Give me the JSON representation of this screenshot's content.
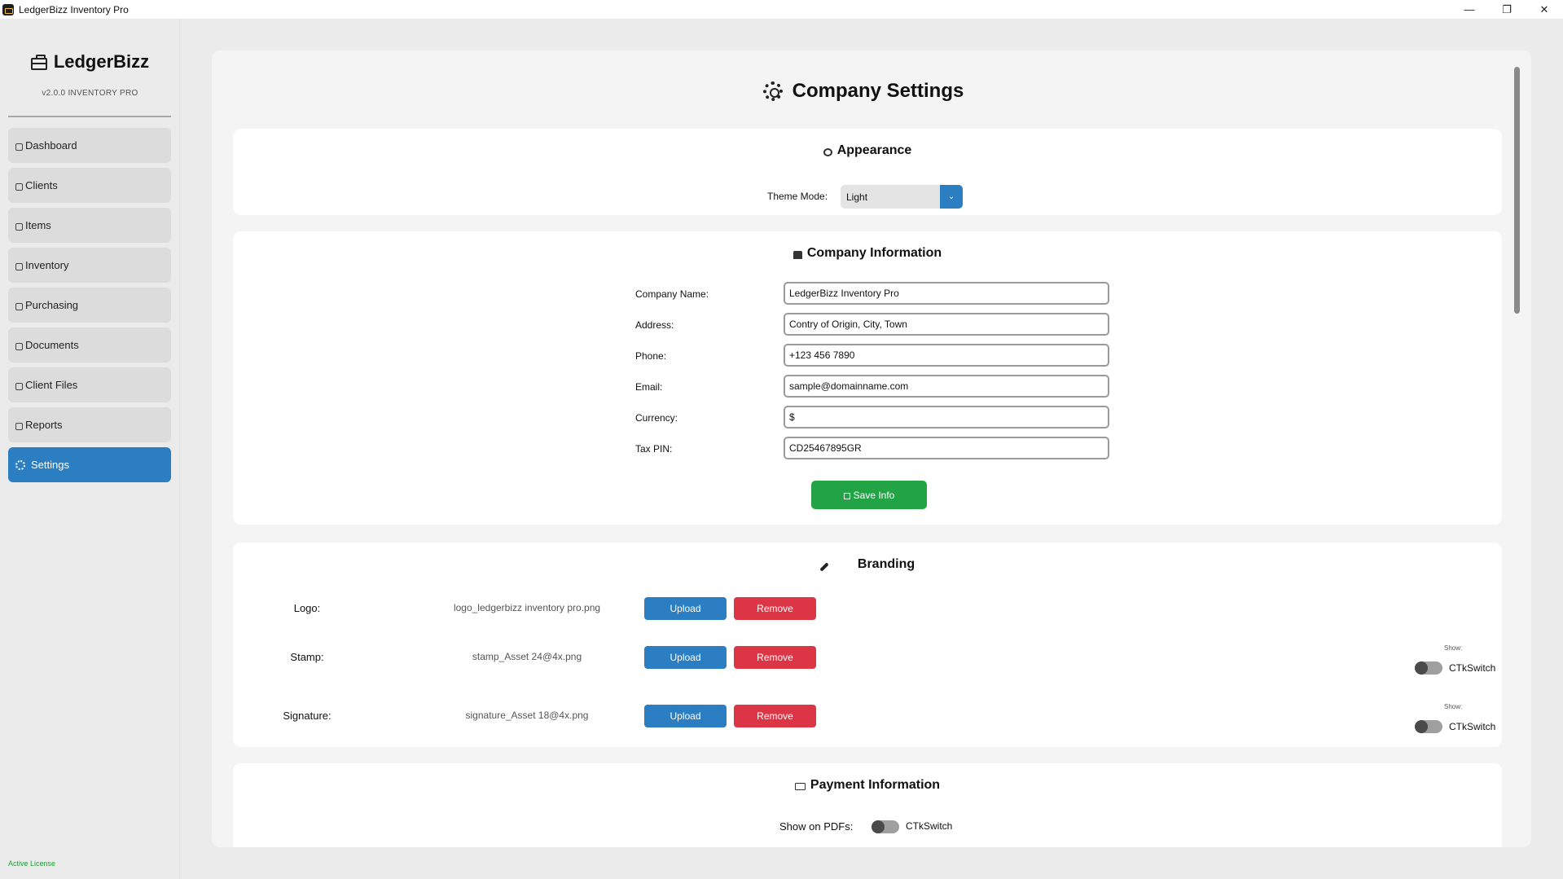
{
  "window": {
    "title": "LedgerBizz Inventory Pro",
    "minimize": "—",
    "maximize": "❐",
    "close": "✕"
  },
  "sidebar": {
    "brand": "LedgerBizz",
    "version": "v2.0.0  INVENTORY PRO",
    "items": [
      {
        "label": "Dashboard",
        "icon": "dashboard-icon"
      },
      {
        "label": "Clients",
        "icon": "clients-icon"
      },
      {
        "label": "Items",
        "icon": "items-icon"
      },
      {
        "label": "Inventory",
        "icon": "inventory-icon"
      },
      {
        "label": "Purchasing",
        "icon": "purchasing-icon"
      },
      {
        "label": "Documents",
        "icon": "documents-icon"
      },
      {
        "label": "Client Files",
        "icon": "client-files-icon"
      },
      {
        "label": "Reports",
        "icon": "reports-icon"
      },
      {
        "label": "Settings",
        "icon": "gear-icon",
        "active": true
      }
    ],
    "license": "Active License"
  },
  "page": {
    "title": "Company Settings"
  },
  "appearance": {
    "title": "Appearance",
    "theme_label": "Theme Mode:",
    "theme_value": "Light"
  },
  "company": {
    "title": "Company Information",
    "fields": [
      {
        "label": "Company Name:",
        "value": "LedgerBizz Inventory Pro"
      },
      {
        "label": "Address:",
        "value": "Contry of Origin, City, Town"
      },
      {
        "label": "Phone:",
        "value": "+123 456 7890"
      },
      {
        "label": "Email:",
        "value": "sample@domainname.com"
      },
      {
        "label": "Currency:",
        "value": "$"
      },
      {
        "label": "Tax PIN:",
        "value": "CD25467895GR"
      }
    ],
    "save_label": "Save Info"
  },
  "branding": {
    "title": "Branding",
    "upload_label": "Upload",
    "remove_label": "Remove",
    "show_label": "Show:",
    "switch_label": "CTkSwitch",
    "rows": [
      {
        "label": "Logo:",
        "file": "logo_ledgerbizz inventory pro.png"
      },
      {
        "label": "Stamp:",
        "file": "stamp_Asset 24@4x.png"
      },
      {
        "label": "Signature:",
        "file": "signature_Asset 18@4x.png"
      }
    ]
  },
  "payment": {
    "title": "Payment Information",
    "show_label": "Show on PDFs:",
    "switch_label": "CTkSwitch"
  },
  "colors": {
    "accent": "#2b7ec2",
    "success": "#22a346",
    "danger": "#dc3545"
  }
}
